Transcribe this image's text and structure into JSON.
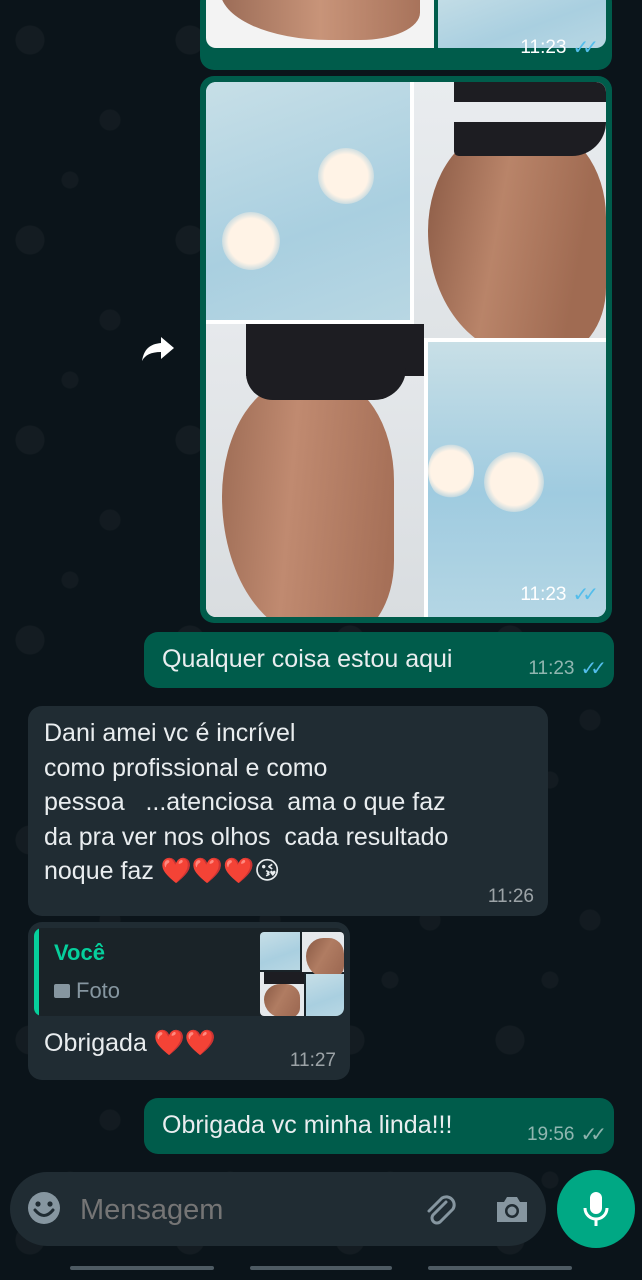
{
  "messages": {
    "img1_time": "11:23",
    "img2_time": "11:23",
    "msg1": {
      "text": "Qualquer coisa estou aqui",
      "time": "11:23"
    },
    "msg2": {
      "lines": [
        "Dani amei vc é incrível",
        "como profissional e como",
        "pessoa   ...atenciosa  ama o que faz",
        "da pra ver nos olhos  cada resultado",
        "noque faz ❤️❤️❤️😘"
      ],
      "time": "11:26"
    },
    "msg3": {
      "quote_author": "Você",
      "quote_type": "Foto",
      "text": "Obrigada ❤️❤️",
      "time": "11:27"
    },
    "msg4": {
      "text": "Obrigada vc minha linda!!!",
      "time": "19:56"
    }
  },
  "composer": {
    "placeholder": "Mensagem",
    "icons": [
      "emoji-icon",
      "attach-icon",
      "camera-icon",
      "mic-icon"
    ]
  },
  "colors": {
    "background": "#0b141a",
    "outgoing_bubble": "#005c4b",
    "incoming_bubble": "#202c33",
    "accent": "#00a884",
    "read_ticks": "#53bdeb"
  }
}
